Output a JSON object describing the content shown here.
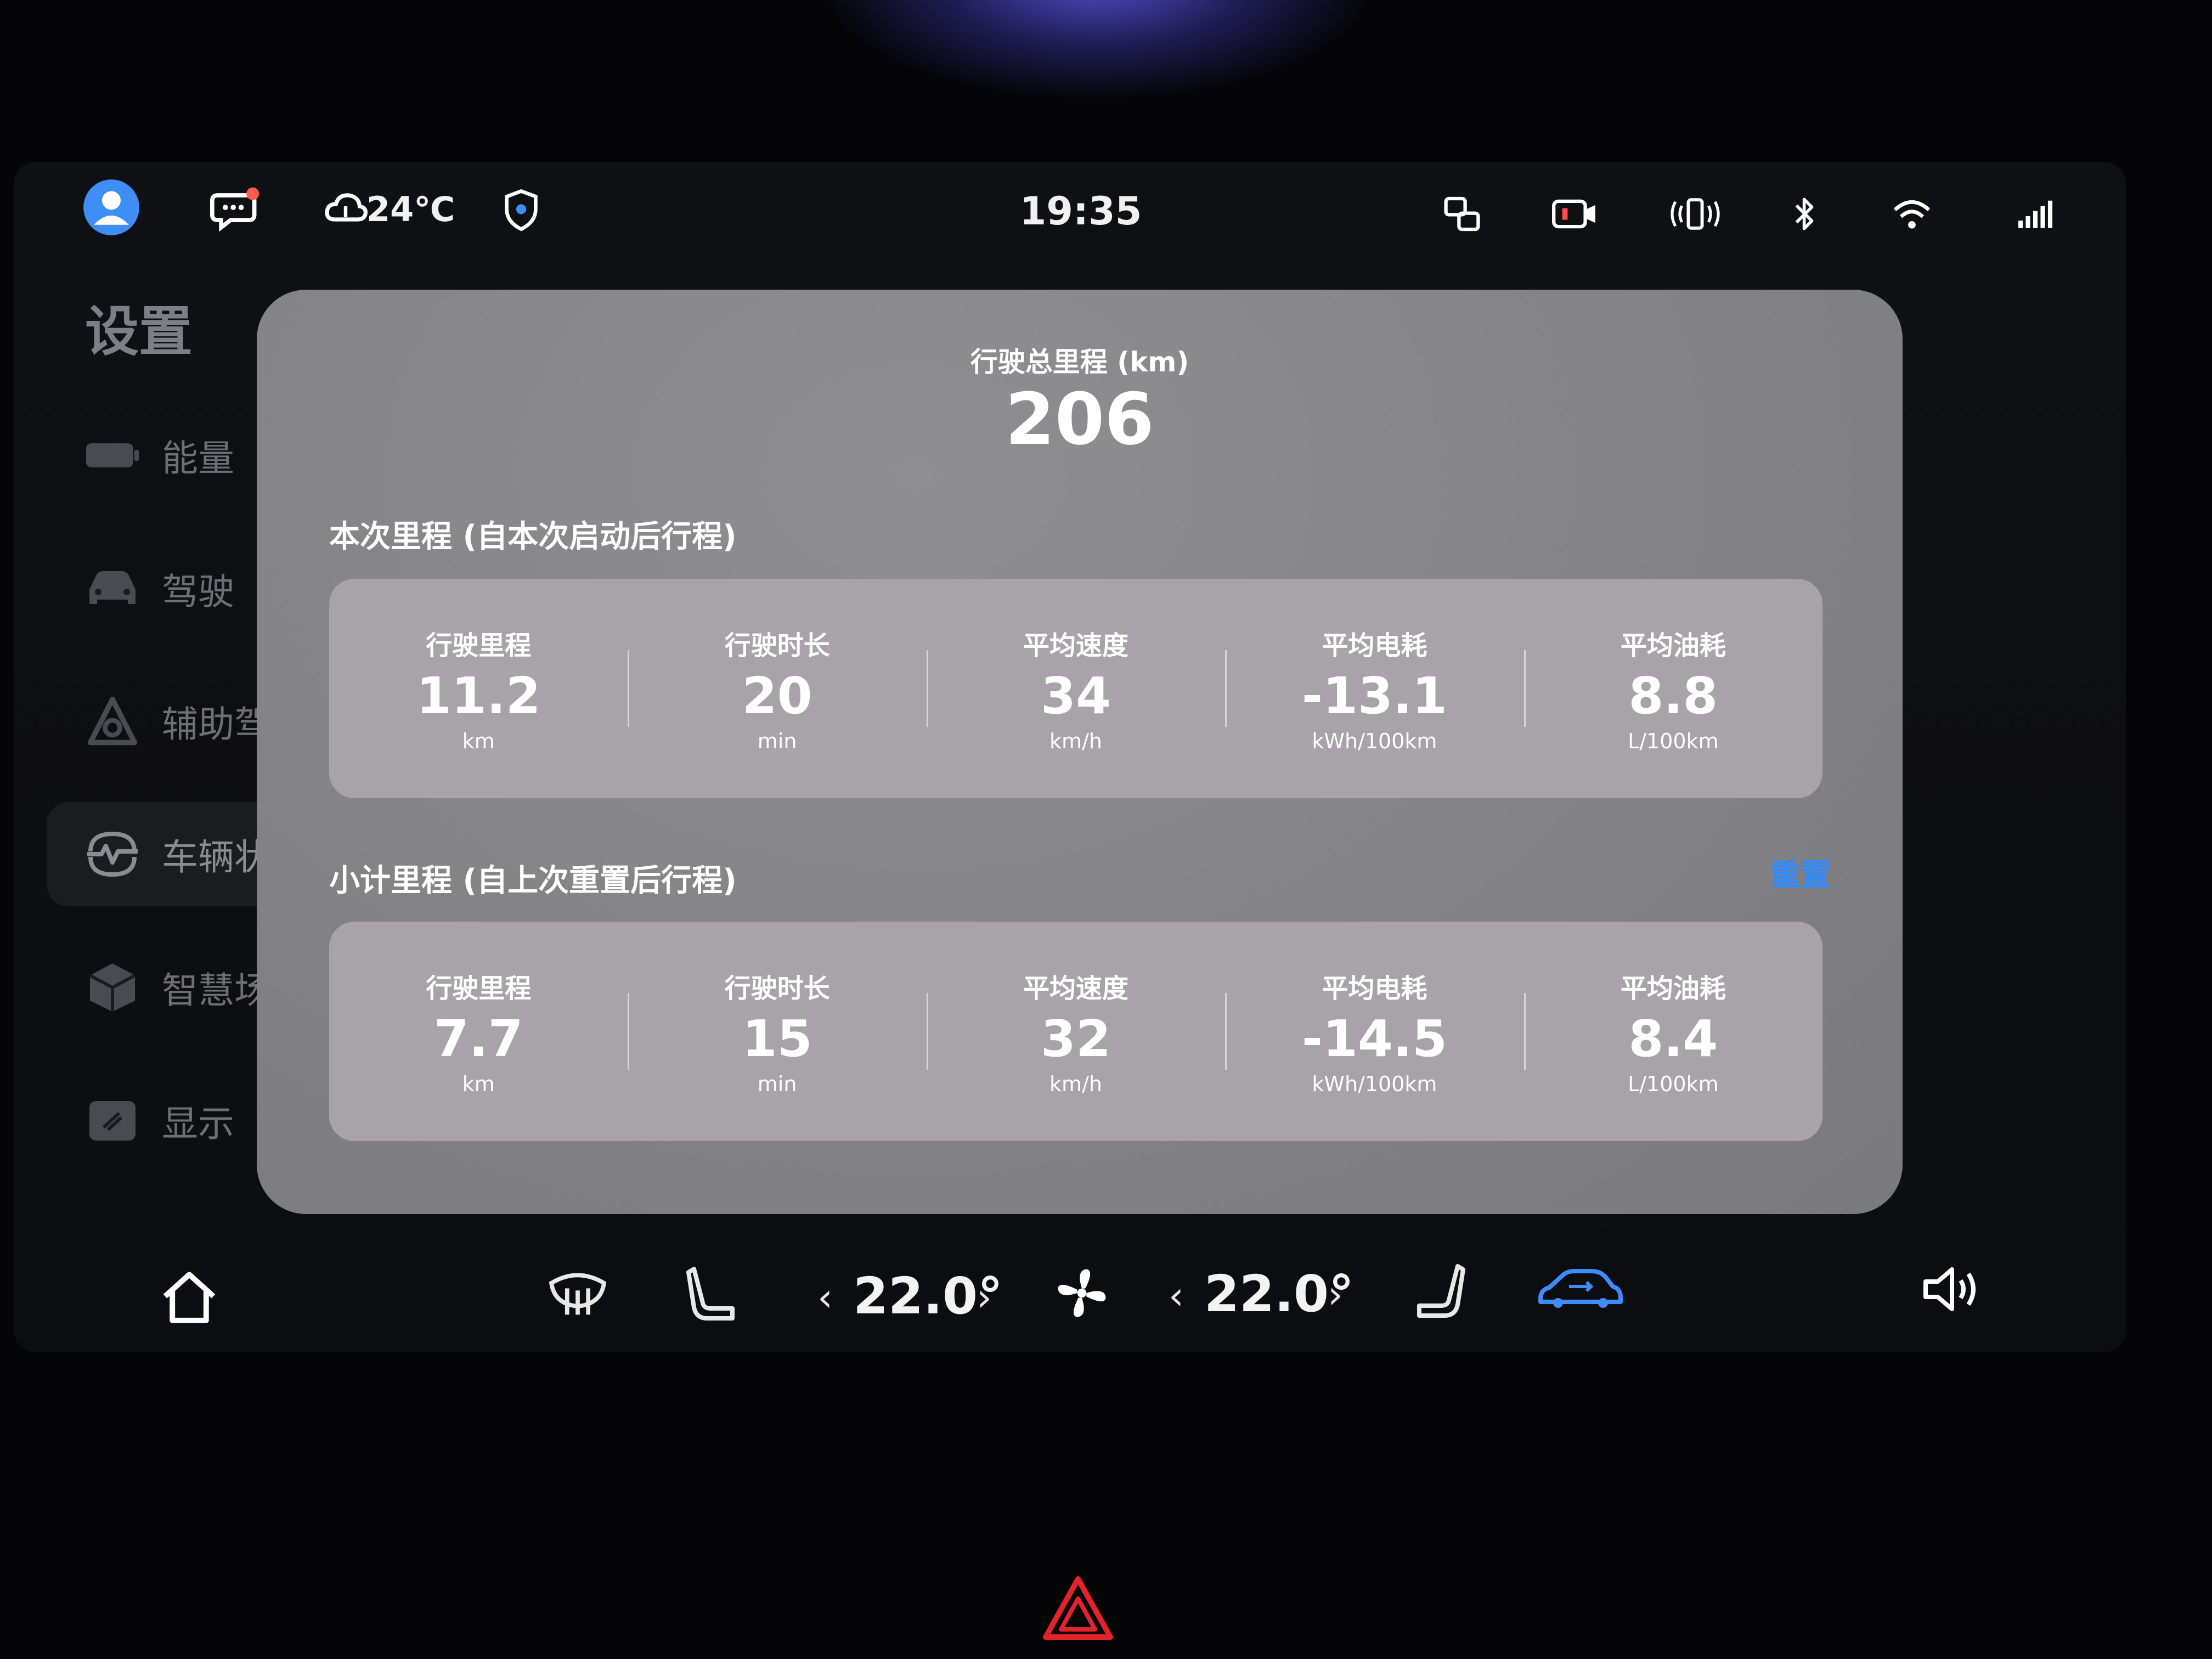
{
  "status_bar": {
    "weather_temp": "24℃",
    "time": "19:35"
  },
  "sidebar": {
    "title": "设置",
    "items": [
      {
        "label": "能量",
        "icon": "battery-icon"
      },
      {
        "label": "驾驶",
        "icon": "car-icon"
      },
      {
        "label": "辅助驾",
        "icon": "assist-icon"
      },
      {
        "label": "车辆状",
        "icon": "vehicle-status-icon",
        "active": true
      },
      {
        "label": "智慧场",
        "icon": "cube-icon"
      },
      {
        "label": "显示",
        "icon": "display-icon"
      }
    ]
  },
  "trip_dialog": {
    "total_label": "行驶总里程 (km)",
    "total_value": "206",
    "current_trip": {
      "title": "本次里程 (自本次启动后行程)",
      "metrics": [
        {
          "label": "行驶里程",
          "value": "11.2",
          "unit": "km"
        },
        {
          "label": "行驶时长",
          "value": "20",
          "unit": "min"
        },
        {
          "label": "平均速度",
          "value": "34",
          "unit": "km/h"
        },
        {
          "label": "平均电耗",
          "value": "-13.1",
          "unit": "kWh/100km"
        },
        {
          "label": "平均油耗",
          "value": "8.8",
          "unit": "L/100km"
        }
      ]
    },
    "subtotal_trip": {
      "title": "小计里程 (自上次重置后行程)",
      "reset_label": "重置",
      "metrics": [
        {
          "label": "行驶里程",
          "value": "7.7",
          "unit": "km"
        },
        {
          "label": "行驶时长",
          "value": "15",
          "unit": "min"
        },
        {
          "label": "平均速度",
          "value": "32",
          "unit": "km/h"
        },
        {
          "label": "平均电耗",
          "value": "-14.5",
          "unit": "kWh/100km"
        },
        {
          "label": "平均油耗",
          "value": "8.4",
          "unit": "L/100km"
        }
      ]
    }
  },
  "climate_bar": {
    "left_temp": "22.0°",
    "right_temp": "22.0°",
    "accent_color": "#3e8cff"
  }
}
